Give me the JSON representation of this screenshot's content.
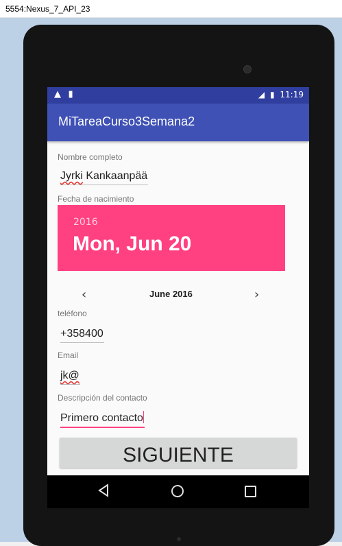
{
  "window": {
    "title": "5554:Nexus_7_API_23"
  },
  "statusbar": {
    "left_icons": [
      "warning-icon",
      "sd-card-icon"
    ],
    "time": "11:19",
    "right_icons": [
      "signal-3g-icon",
      "battery-icon"
    ]
  },
  "appbar": {
    "title": "MiTareaCurso3Semana2"
  },
  "form": {
    "name_label": "Nombre completo",
    "name_value_a": "Jyrki",
    "name_value_b": " Kankaanpää",
    "dob_label": "Fecha de nacimiento",
    "datepicker": {
      "year": "2016",
      "date": "Mon, Jun 20",
      "month": "June 2016"
    },
    "phone_label": "teléfono",
    "phone_value": "+358400",
    "email_label": "Email",
    "email_value": "jk@",
    "desc_label": "Descripción del contacto",
    "desc_value": "Primero contacto",
    "next_button": "SIGUIENTE"
  },
  "colors": {
    "primary": "#3f51b5",
    "primary_dark": "#303f9f",
    "accent": "#ff4081"
  }
}
